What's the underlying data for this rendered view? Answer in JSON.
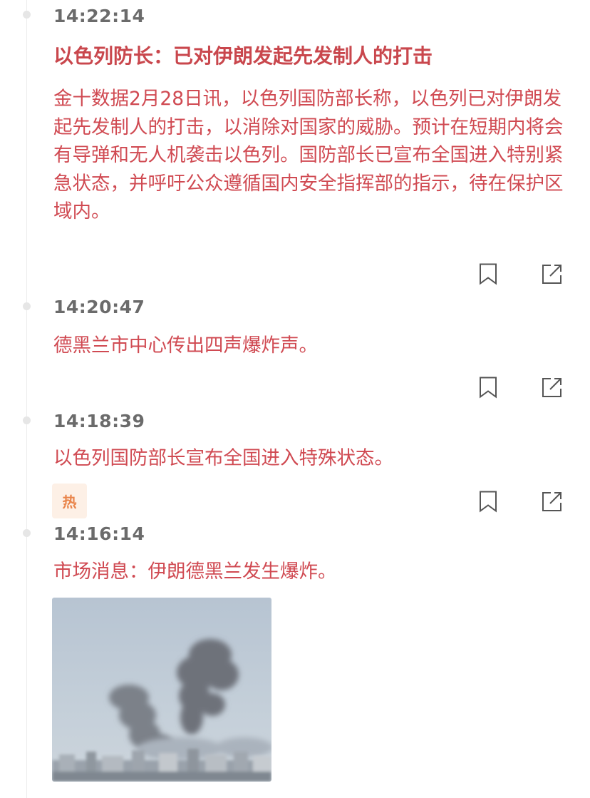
{
  "feed": {
    "items": [
      {
        "time": "14:22:14",
        "title": "以色列防长：已对伊朗发起先发制人的打击",
        "content": "金十数据2月28日讯，以色列国防部长称，以色列已对伊朗发起先发制人的打击，以消除对国家的威胁。预计在短期内将会有导弹和无人机袭击以色列。国防部长已宣布全国进入特别紧急状态，并呼吁公众遵循国内安全指挥部的指示，待在保护区域内。"
      },
      {
        "time": "14:20:47",
        "content": "德黑兰市中心传出四声爆炸声。"
      },
      {
        "time": "14:18:39",
        "content": "以色列国防部长宣布全国进入特殊状态。",
        "badge": "热"
      },
      {
        "time": "14:16:14",
        "content": "市场消息：伊朗德黑兰发生爆炸。"
      }
    ]
  },
  "icons": {
    "bookmark": "bookmark-icon",
    "share": "share-icon"
  },
  "colors": {
    "headline": "#c9474d",
    "content_text": "#d04a52",
    "time_text": "#6b6b6b",
    "hot_badge_bg": "#fdf0e6",
    "hot_badge_text": "#e9844a",
    "timeline": "#ececec"
  }
}
